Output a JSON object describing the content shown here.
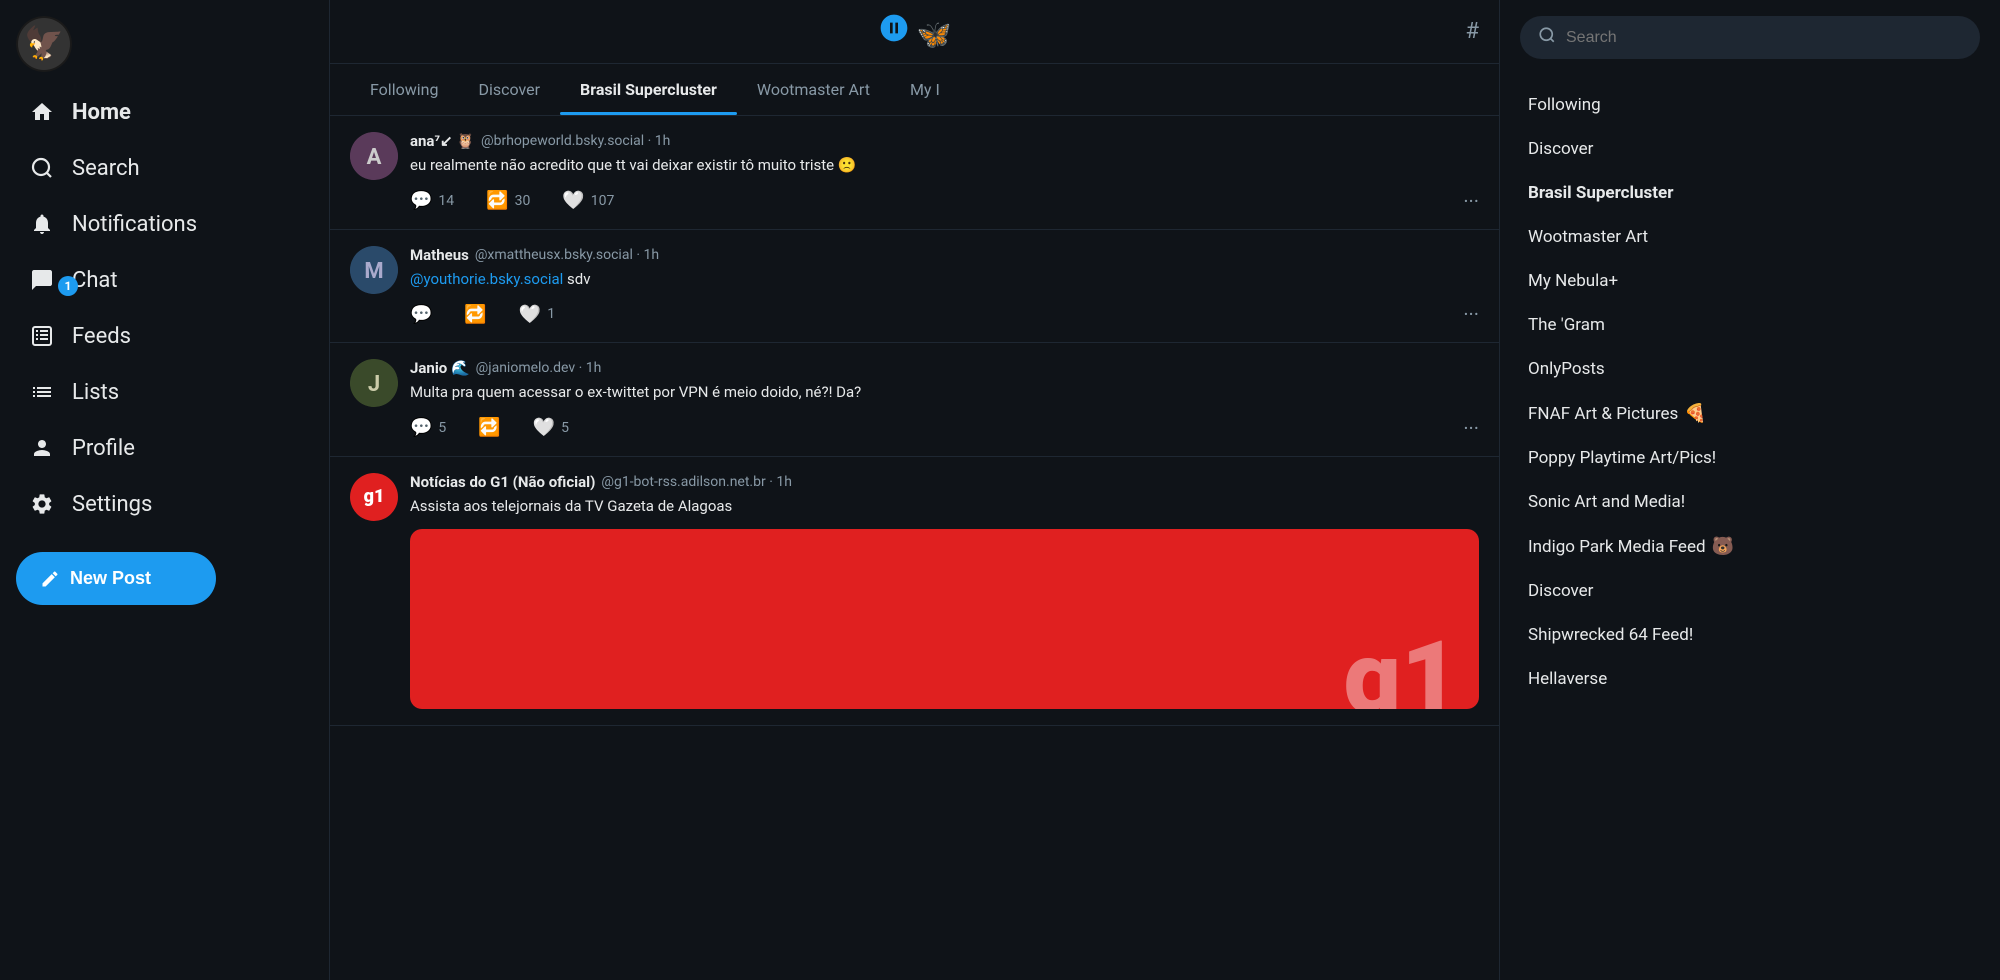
{
  "sidebar": {
    "nav_items": [
      {
        "id": "home",
        "label": "Home",
        "icon": "🏠",
        "active": true
      },
      {
        "id": "search",
        "label": "Search",
        "icon": "🔍",
        "active": false
      },
      {
        "id": "notifications",
        "label": "Notifications",
        "icon": "🔔",
        "active": false
      },
      {
        "id": "chat",
        "label": "Chat",
        "icon": "💬",
        "active": false,
        "badge": "1"
      },
      {
        "id": "feeds",
        "label": "Feeds",
        "icon": "#",
        "active": false
      },
      {
        "id": "lists",
        "label": "Lists",
        "icon": "≡",
        "active": false
      },
      {
        "id": "profile",
        "label": "Profile",
        "icon": "👤",
        "active": false
      },
      {
        "id": "settings",
        "label": "Settings",
        "icon": "⚙️",
        "active": false
      }
    ],
    "new_post_label": "New Post"
  },
  "feed": {
    "header_hash": "#",
    "tabs": [
      {
        "id": "following",
        "label": "Following",
        "active": false
      },
      {
        "id": "discover",
        "label": "Discover",
        "active": false
      },
      {
        "id": "brasil-supercluster",
        "label": "Brasil Supercluster",
        "active": true
      },
      {
        "id": "wootmaster-art",
        "label": "Wootmaster Art",
        "active": false
      },
      {
        "id": "my-nebula",
        "label": "My I",
        "active": false
      }
    ],
    "posts": [
      {
        "id": "post1",
        "author": "ana⁷↙",
        "author_emoji": "🦉",
        "handle": "@brhopeworld.bsky.social",
        "time": "1h",
        "text": "eu realmente não acredito que tt vai deixar existir tô muito triste 🙁",
        "avatar_initials": "A",
        "avatar_color": "#5a3a5a",
        "reply_count": "14",
        "repost_count": "30",
        "like_count": "107",
        "has_more": true
      },
      {
        "id": "post2",
        "author": "Matheus",
        "handle": "@xmattheusx.bsky.social",
        "time": "1h",
        "text": "",
        "mention": "@youthorie.bsky.social",
        "mention_suffix": " sdv",
        "avatar_initials": "M",
        "avatar_color": "#2a4a6a",
        "reply_count": "",
        "repost_count": "",
        "like_count": "1",
        "has_more": true
      },
      {
        "id": "post3",
        "author": "Janio",
        "author_emoji": "🌊",
        "handle": "@janiomelo.dev",
        "time": "1h",
        "text": "Multa pra quem acessar o ex-twittet por VPN é meio doido, né?! Da?",
        "avatar_initials": "J",
        "avatar_color": "#4a5a2a",
        "reply_count": "5",
        "repost_count": "",
        "like_count": "5",
        "has_more": true
      },
      {
        "id": "post4",
        "author": "Notícias do G1 (Não oficial)",
        "handle": "@g1-bot-rss.adilson.net.br",
        "time": "1h",
        "text": "Assista aos telejornais da TV Gazeta de Alagoas",
        "avatar_initials": "g1",
        "avatar_color": "#e02020",
        "is_g1": true,
        "has_image": true
      }
    ]
  },
  "right_sidebar": {
    "search_placeholder": "Search",
    "feed_list": [
      {
        "id": "following",
        "label": "Following",
        "active": false
      },
      {
        "id": "discover",
        "label": "Discover",
        "active": false
      },
      {
        "id": "brasil-supercluster",
        "label": "Brasil Supercluster",
        "active": true
      },
      {
        "id": "wootmaster-art",
        "label": "Wootmaster Art",
        "active": false
      },
      {
        "id": "my-nebula",
        "label": "My Nebula+",
        "active": false
      },
      {
        "id": "the-gram",
        "label": "The 'Gram",
        "active": false
      },
      {
        "id": "onlyposts",
        "label": "OnlyPosts",
        "active": false
      },
      {
        "id": "fnaf-art",
        "label": "FNAF Art & Pictures",
        "emoji": "🍕",
        "active": false
      },
      {
        "id": "poppy-playtime",
        "label": "Poppy Playtime Art/Pics!",
        "active": false
      },
      {
        "id": "sonic-art",
        "label": "Sonic Art and Media!",
        "active": false
      },
      {
        "id": "indigo-park",
        "label": "Indigo Park Media Feed",
        "emoji": "🐻",
        "active": false
      },
      {
        "id": "discover2",
        "label": "Discover",
        "active": false
      },
      {
        "id": "shipwrecked",
        "label": "Shipwrecked 64 Feed!",
        "active": false
      },
      {
        "id": "hellaverse",
        "label": "Hellaverse",
        "active": false
      }
    ]
  }
}
